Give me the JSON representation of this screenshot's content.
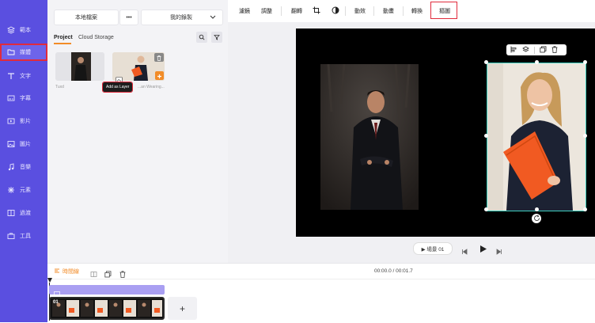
{
  "nav": {
    "items": [
      {
        "label": "範本",
        "icon": "template-icon"
      },
      {
        "label": "媒體",
        "icon": "folder-icon"
      },
      {
        "label": "文字",
        "icon": "text-icon"
      },
      {
        "label": "字幕",
        "icon": "subtitle-icon"
      },
      {
        "label": "影片",
        "icon": "video-icon"
      },
      {
        "label": "圖片",
        "icon": "image-icon"
      },
      {
        "label": "音樂",
        "icon": "music-icon"
      },
      {
        "label": "元素",
        "icon": "elements-icon"
      },
      {
        "label": "過渡",
        "icon": "transition-icon"
      },
      {
        "label": "工具",
        "icon": "tools-icon"
      }
    ]
  },
  "panel": {
    "local_files": "本地檔案",
    "more": "•••",
    "my_recordings": "我的錄製",
    "tabs": [
      "Project",
      "Cloud Storage"
    ],
    "tooltip": "Add as Layer",
    "thumbs": [
      {
        "caption": "Tuxd"
      },
      {
        "caption": "...an Wearing..."
      }
    ]
  },
  "toolbar": {
    "items": [
      "濾鏡",
      "調整",
      "翻轉",
      "裁切",
      "色彩",
      "動效",
      "動畫",
      "轉換",
      "摳圖"
    ]
  },
  "playback": {
    "scene_label": "▶ 場景 01",
    "time": "00:00.0 / 00:01.7"
  },
  "timeline": {
    "timeline_label": "時間線",
    "clip_number": "01",
    "add": "+"
  },
  "colors": {
    "nav_bg": "#5a4fe0",
    "accent": "#f28c28",
    "highlight": "#e02b3c",
    "selection": "#3fd0c0"
  }
}
